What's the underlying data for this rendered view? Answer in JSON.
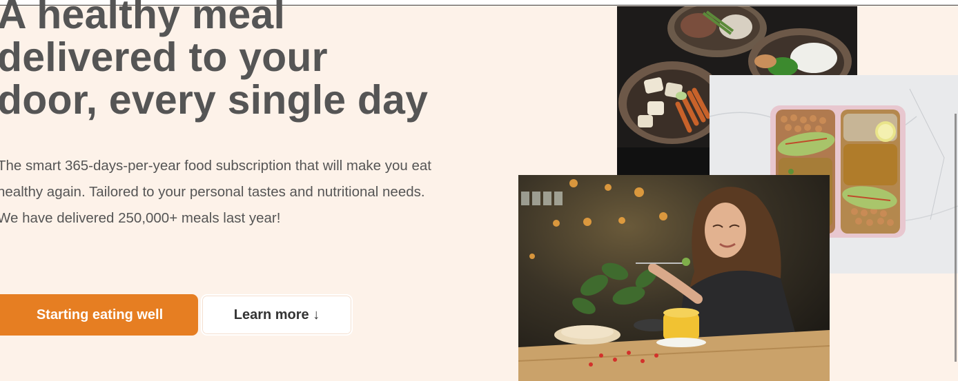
{
  "hero": {
    "heading_lines": [
      "A healthy meal",
      "delivered to your",
      "door, every single day"
    ],
    "description": "The smart 365-days-per-year food subscription that will make you eat healthy again. Tailored to your personal tastes and nutritional needs. We have delivered 250,000+ meals last year!",
    "primary_cta": "Starting eating well",
    "secondary_cta": "Learn more ↓"
  },
  "colors": {
    "background": "#fdf2e9",
    "accent": "#e67e22",
    "text": "#555555"
  },
  "icons": {
    "secondary_cta_arrow": "down-arrow-icon"
  }
}
